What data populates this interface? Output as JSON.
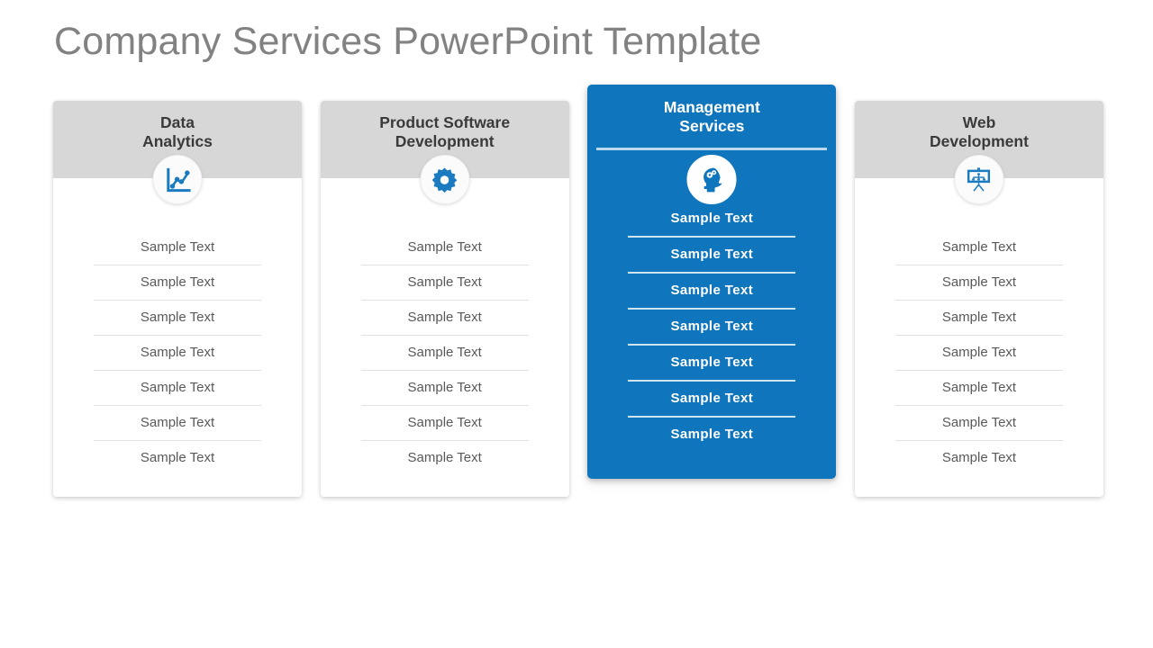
{
  "slide": {
    "title": "Company Services PowerPoint Template",
    "background_color": "#FFFFFF",
    "title_color": "#828282",
    "accent_color": "#0F75BC",
    "header_gray": "#D7D7D7"
  },
  "columns": [
    {
      "title_line1": "Data",
      "title_line2": "Analytics",
      "icon": "line-chart-icon",
      "highlighted": false,
      "rows": [
        "Sample Text",
        "Sample Text",
        "Sample Text",
        "Sample Text",
        "Sample Text",
        "Sample Text",
        "Sample Text"
      ]
    },
    {
      "title_line1": "Product Software",
      "title_line2": "Development",
      "icon": "gear-icon",
      "highlighted": false,
      "rows": [
        "Sample Text",
        "Sample Text",
        "Sample Text",
        "Sample Text",
        "Sample Text",
        "Sample Text",
        "Sample Text"
      ]
    },
    {
      "title_line1": "Management",
      "title_line2": "Services",
      "icon": "head-gears-icon",
      "highlighted": true,
      "rows": [
        "Sample Text",
        "Sample Text",
        "Sample Text",
        "Sample Text",
        "Sample Text",
        "Sample Text",
        "Sample Text"
      ]
    },
    {
      "title_line1": "Web",
      "title_line2": "Development",
      "icon": "presentation-board-icon",
      "highlighted": false,
      "rows": [
        "Sample Text",
        "Sample Text",
        "Sample Text",
        "Sample Text",
        "Sample Text",
        "Sample Text",
        "Sample Text"
      ]
    }
  ]
}
